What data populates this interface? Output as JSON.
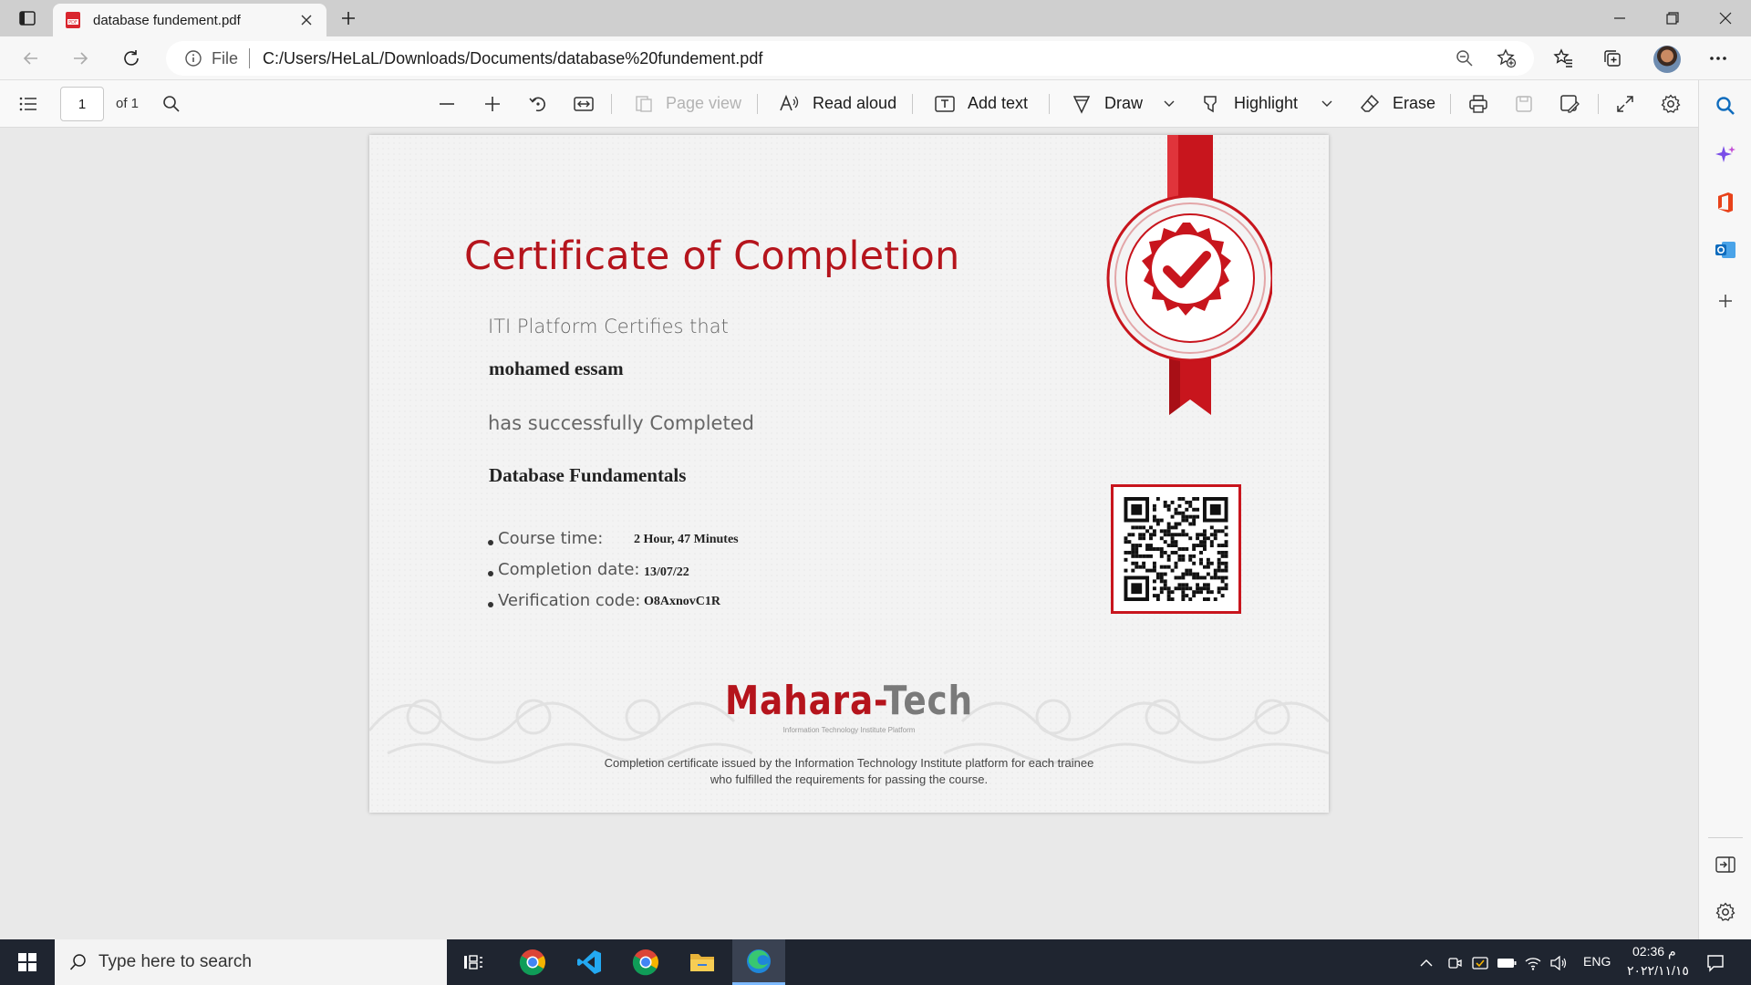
{
  "browser": {
    "tab_title": "database fundement.pdf",
    "address": {
      "scheme_label": "File",
      "url": "C:/Users/HeLaL/Downloads/Documents/database%20fundement.pdf"
    }
  },
  "pdf_toolbar": {
    "page_number": "1",
    "page_total": "of 1",
    "page_view": "Page view",
    "read_aloud": "Read aloud",
    "add_text": "Add text",
    "draw": "Draw",
    "highlight": "Highlight",
    "erase": "Erase"
  },
  "certificate": {
    "title": "Certificate of Completion",
    "certifies_line": "ITI Platform Certifies that",
    "recipient": "mohamed essam",
    "completed_line": "has successfully Completed",
    "course": "Database Fundamentals",
    "details": [
      {
        "label": "Course time:",
        "value": "2 Hour, 47 Minutes"
      },
      {
        "label": "Completion date:",
        "value": "13/07/22"
      },
      {
        "label": "Verification code:",
        "value": "O8AxnovC1R"
      }
    ],
    "brand_part1": "Mahara-",
    "brand_part2": "Tech",
    "brand_tagline": "Information Technology Institute Platform",
    "footer_line1": "Completion certificate issued by the Information Technology Institute platform  for each trainee",
    "footer_line2": "who fulfilled the requirements for passing the course."
  },
  "taskbar": {
    "search_placeholder": "Type here to search",
    "language": "ENG",
    "time": "02:36 م",
    "date": "٢٠٢٢/١١/١٥"
  },
  "colors": {
    "accent_red": "#b5141c",
    "edge_blue": "#0f6cbd",
    "taskbar": "#1f2530"
  },
  "icons": [
    "tab-actions-icon",
    "pdf-file-icon",
    "close-icon",
    "new-tab-icon",
    "minimize-icon",
    "maximize-icon",
    "window-close-icon",
    "back-icon",
    "forward-icon",
    "refresh-icon",
    "info-icon",
    "zoom-icon",
    "favorite-add-icon",
    "favorites-icon",
    "collections-icon",
    "more-icon",
    "contents-icon",
    "search-icon",
    "zoom-out-icon",
    "zoom-in-icon",
    "rotate-icon",
    "fit-page-icon",
    "read-aloud-icon",
    "add-text-icon",
    "draw-icon",
    "highlight-icon",
    "erase-icon",
    "print-icon",
    "save-icon",
    "save-as-icon",
    "fullscreen-icon",
    "settings-icon",
    "copilot-icon",
    "office-icon",
    "outlook-icon",
    "add-icon",
    "sidebar-hide-icon",
    "windows-start-icon",
    "task-view-icon",
    "chrome-icon",
    "vscode-icon",
    "file-explorer-icon",
    "edge-icon",
    "notification-icon"
  ]
}
